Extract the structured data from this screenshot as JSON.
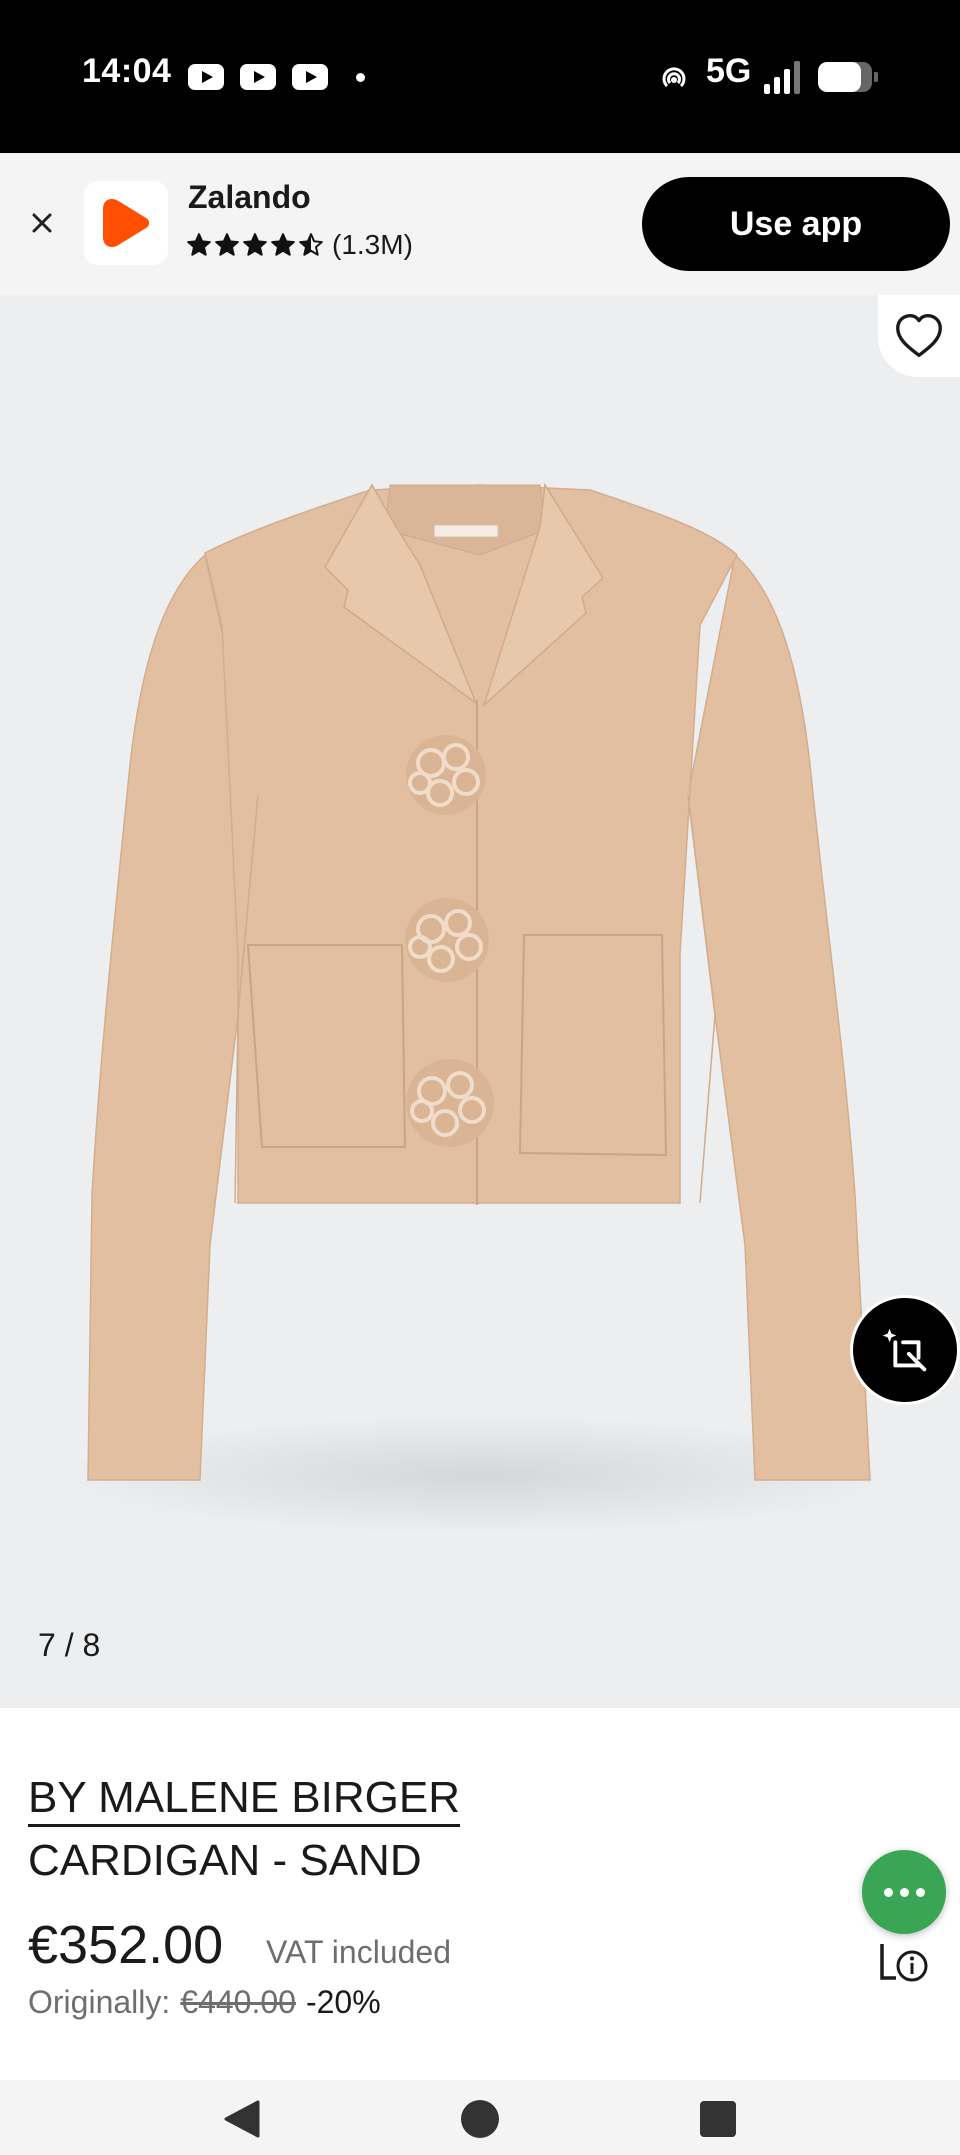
{
  "status_bar": {
    "time": "14:04",
    "network": "5G",
    "battery_level": 0.8,
    "notification_icons": [
      "youtube-icon",
      "youtube-icon",
      "youtube-icon"
    ]
  },
  "app_banner": {
    "app_name": "Zalando",
    "rating_stars": 4.5,
    "rating_count": "(1.3M)",
    "use_app_label": "Use app",
    "brand_color": "#ff4f00"
  },
  "gallery": {
    "pager": "7 / 8",
    "background_color": "#eceeef",
    "product_color": "#e2bfa0"
  },
  "product": {
    "brand": "BY MALENE BIRGER",
    "name": "CARDIGAN - SAND",
    "price": "€352.00",
    "vat_note": "VAT included",
    "original_label": "Originally:",
    "original_price": "€440.00",
    "discount": "-20%"
  },
  "chat": {
    "accent_color": "#3aa655"
  }
}
